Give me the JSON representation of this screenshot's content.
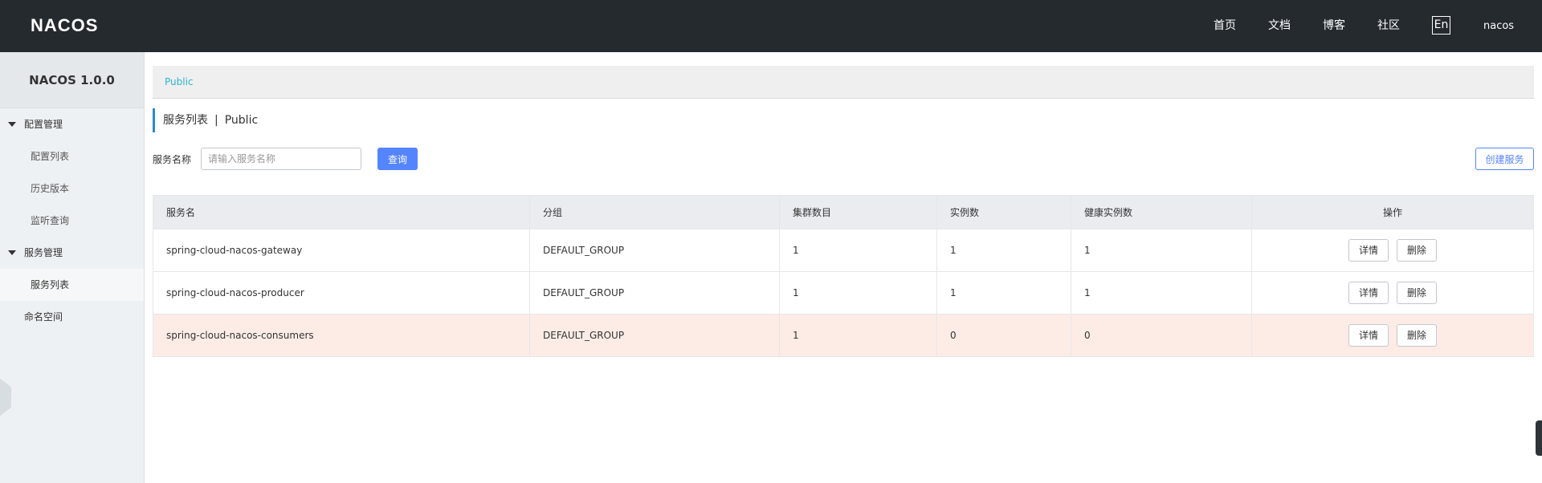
{
  "header": {
    "logo": "NACOS",
    "nav": [
      "首页",
      "文档",
      "博客",
      "社区"
    ],
    "lang": "En",
    "user": "nacos"
  },
  "sidebar": {
    "version": "NACOS 1.0.0",
    "groups": [
      {
        "label": "配置管理",
        "items": [
          "配置列表",
          "历史版本",
          "监听查询"
        ]
      },
      {
        "label": "服务管理",
        "items": [
          "服务列表"
        ]
      }
    ],
    "namespace": "命名空间"
  },
  "main": {
    "breadcrumb": "Public",
    "title": "服务列表",
    "title_sep": "|",
    "title_ns": "Public",
    "search": {
      "label": "服务名称",
      "placeholder": "请输入服务名称",
      "query": "查询",
      "create": "创建服务"
    },
    "table": {
      "headers": [
        "服务名",
        "分组",
        "集群数目",
        "实例数",
        "健康实例数",
        "操作"
      ],
      "rows": [
        {
          "name": "spring-cloud-nacos-gateway",
          "group": "DEFAULT_GROUP",
          "clusters": "1",
          "instances": "1",
          "healthy": "1",
          "detail": "详情",
          "delete": "删除"
        },
        {
          "name": "spring-cloud-nacos-producer",
          "group": "DEFAULT_GROUP",
          "clusters": "1",
          "instances": "1",
          "healthy": "1",
          "detail": "详情",
          "delete": "删除"
        },
        {
          "name": "spring-cloud-nacos-consumers",
          "group": "DEFAULT_GROUP",
          "clusters": "1",
          "instances": "0",
          "healthy": "0",
          "detail": "详情",
          "delete": "删除"
        }
      ]
    }
  },
  "colors": {
    "header_bg": "#252a2f",
    "primary": "#5584ff",
    "highlight_row": "#fdece6"
  }
}
